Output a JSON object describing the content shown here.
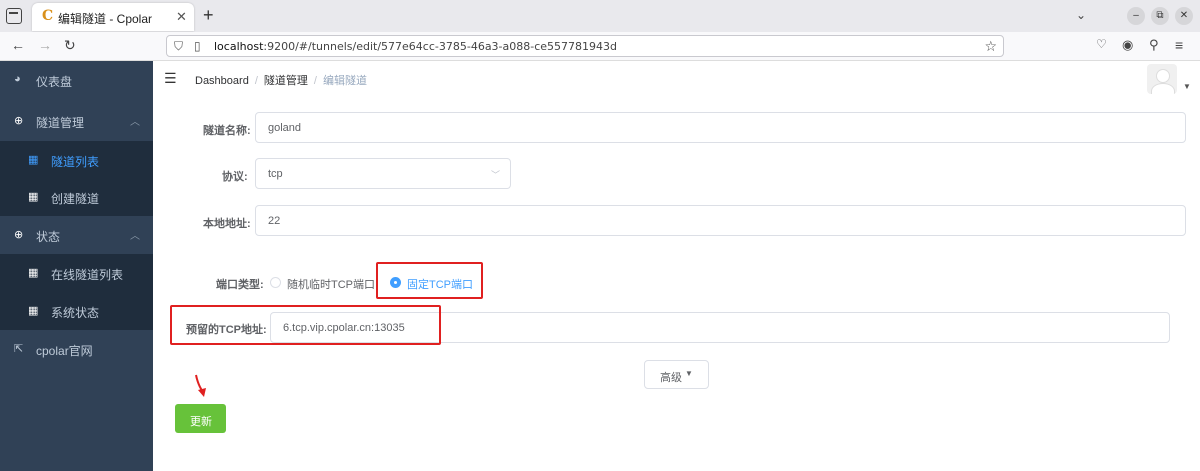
{
  "browser": {
    "tab_title": "编辑隧道 - Cpolar",
    "tab_favicon": "C",
    "url_host": "localhost",
    "url_rest": ":9200/#/tunnels/edit/577e64cc-3785-46a3-a088-ce557781943d",
    "icons": [
      "tab-overview-icon",
      "close-icon",
      "new-tab-icon",
      "chevron-down-icon",
      "minimize-icon",
      "restore-icon",
      "window-close-icon",
      "back-icon",
      "forward-icon",
      "reload-icon",
      "shield-icon",
      "page-icon",
      "bookmark-star-icon",
      "pocket-icon",
      "account-icon",
      "extensions-icon",
      "menu-icon"
    ]
  },
  "sidebar": {
    "items": [
      {
        "label": "仪表盘",
        "icon": "dashboard-icon"
      },
      {
        "label": "隧道管理",
        "icon": "plus-circle-icon"
      },
      {
        "label": "隧道列表",
        "icon": "grid-icon"
      },
      {
        "label": "创建隧道",
        "icon": "grid-icon"
      },
      {
        "label": "状态",
        "icon": "plus-circle-icon"
      },
      {
        "label": "在线隧道列表",
        "icon": "grid-icon"
      },
      {
        "label": "系统状态",
        "icon": "grid-icon"
      },
      {
        "label": "cpolar官网",
        "icon": "external-link-icon"
      }
    ],
    "bg_color": "#304156",
    "active_color": "#409eff"
  },
  "breadcrumb": {
    "items": [
      "Dashboard",
      "隧道管理",
      "编辑隧道"
    ]
  },
  "form": {
    "name_label": "隧道名称:",
    "name_value": "goland",
    "protocol_label": "协议:",
    "protocol_value": "tcp",
    "local_addr_label": "本地地址:",
    "local_addr_value": "22",
    "port_type_label": "端口类型:",
    "port_type_options": [
      "随机临时TCP端口",
      "固定TCP端口"
    ],
    "port_type_selected": "固定TCP端口",
    "reserved_label": "预留的TCP地址:",
    "reserved_value": "6.tcp.vip.cpolar.cn:13035",
    "advanced_label": "高级",
    "update_label": "更新"
  },
  "colors": {
    "highlight": "#e02020",
    "update_button": "#67c23a"
  }
}
